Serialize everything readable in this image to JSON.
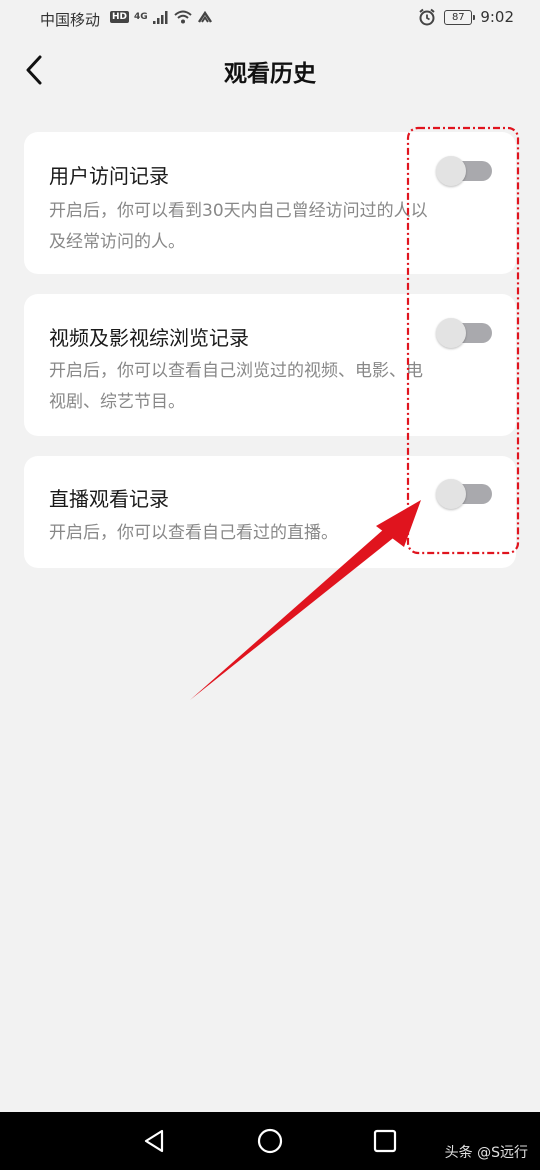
{
  "status_bar": {
    "carrier": "中国移动",
    "hd_badge": "HD",
    "network": "4G",
    "battery": "87",
    "time": "9:02"
  },
  "header": {
    "title": "观看历史",
    "back_icon": "chevron-left-icon"
  },
  "settings": [
    {
      "title": "用户访问记录",
      "desc_line1": "开启后，你可以看到30天内自己曾经访问过的人以",
      "desc_line2": "及经常访问的人。",
      "enabled": false
    },
    {
      "title": "视频及影视综浏览记录",
      "desc_line1": "开启后，你可以查看自己浏览过的视频、电影、电",
      "desc_line2": "视剧、综艺节目。",
      "enabled": false
    },
    {
      "title": "直播观看记录",
      "desc_line1": "开启后，你可以查看自己看过的直播。",
      "desc_line2": "",
      "enabled": false
    }
  ],
  "annotation_color": "#e0141e",
  "nav_bar": {
    "icons": [
      "back-triangle-icon",
      "home-circle-icon",
      "recents-square-icon"
    ]
  },
  "watermark": "头条 @S远行"
}
